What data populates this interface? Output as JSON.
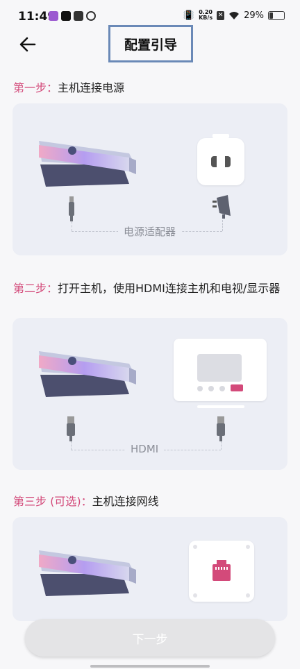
{
  "status": {
    "time": "11:49",
    "net_speed_value": "0.20",
    "net_speed_unit": "KB/s",
    "battery": "29%",
    "battery_level": 0.29
  },
  "header": {
    "title": "配置引导",
    "back_icon": "arrow-left-icon"
  },
  "steps": [
    {
      "prefix": "第一步：",
      "text": "主机连接电源",
      "connector_label": "电源适配器"
    },
    {
      "prefix": "第二步：",
      "text": "打开主机，使用HDMI连接主机和电视/显示器",
      "connector_label": "HDMI"
    },
    {
      "prefix": "第三步 (可选)：",
      "text": "主机连接网线",
      "connector_label": ""
    }
  ],
  "footer": {
    "next_label": "下一步"
  },
  "colors": {
    "accent": "#d34a7a",
    "card_bg": "#eceef5",
    "title_border": "#6a89b7",
    "button_bg": "#e4e4e6"
  }
}
